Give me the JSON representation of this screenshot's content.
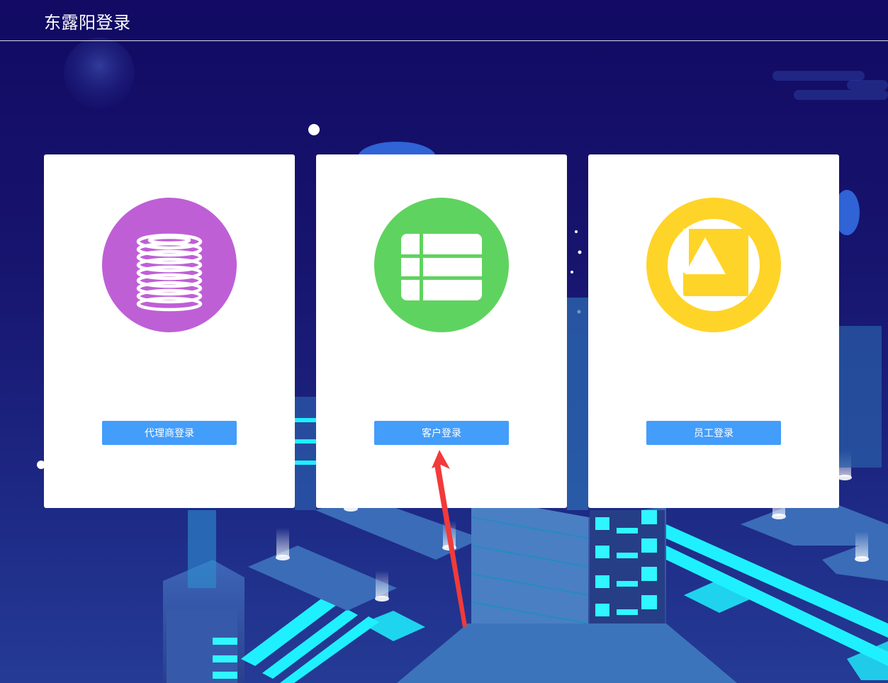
{
  "header": {
    "title": "东露阳登录"
  },
  "cards": [
    {
      "id": "agent",
      "icon": "coin-stack-icon",
      "icon_color": "#bf5fd6",
      "button_label": "代理商登录"
    },
    {
      "id": "client",
      "icon": "table-grid-icon",
      "icon_color": "#5fd35f",
      "button_label": "客户登录"
    },
    {
      "id": "staff",
      "icon": "framed-triangle-icon",
      "icon_color": "#ffd428",
      "button_label": "员工登录"
    }
  ],
  "colors": {
    "background": "#150f66",
    "button": "#439dfa",
    "annotation_arrow": "#f23a3a"
  }
}
